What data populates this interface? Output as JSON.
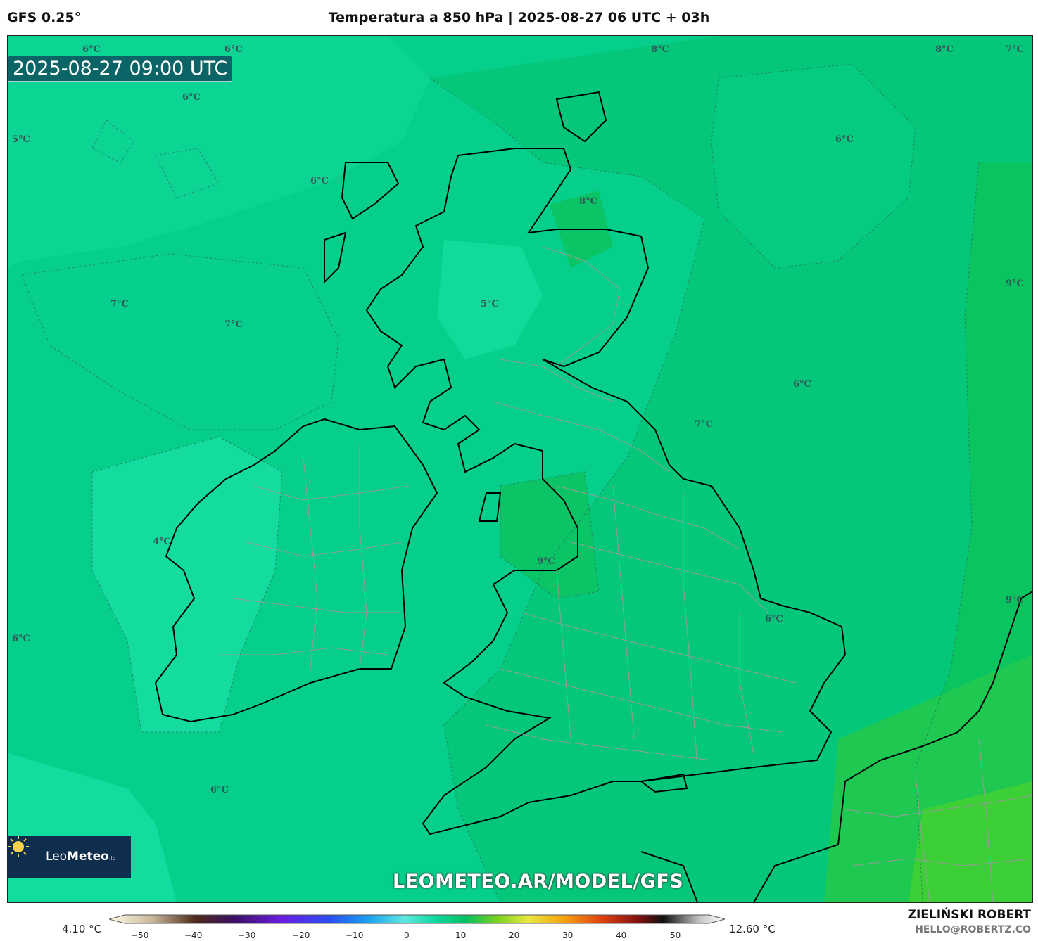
{
  "header": {
    "model": "GFS 0.25°",
    "title": "Temperatura a 850 hPa | 2025-08-27 06 UTC + 03h"
  },
  "valid_time": "2025-08-27 09:00 UTC",
  "map": {
    "region": "British Isles",
    "labels": [
      "6°C",
      "6°C",
      "8°C",
      "8°C",
      "7°C",
      "5°C",
      "6°C",
      "6°C",
      "6°C",
      "8°C",
      "7°C",
      "7°C",
      "9°C",
      "5°C",
      "6°C",
      "7°C",
      "4°C",
      "9°C",
      "9°C",
      "6°C",
      "6°C",
      "6°C"
    ]
  },
  "watermark": "LEOMETEO.AR/MODEL/GFS",
  "logo": {
    "text_regular": "Leo",
    "text_bold": "Meteo",
    "suffix": ".io"
  },
  "colorbar": {
    "min_label": "4.10 °C",
    "max_label": "12.60 °C",
    "ticks": [
      "−50",
      "−40",
      "−30",
      "−20",
      "−10",
      "0",
      "10",
      "20",
      "30",
      "40",
      "50"
    ]
  },
  "credits": {
    "author": "ZIELIŃSKI ROBERT",
    "email": "HELLO@ROBERTZ.CO"
  },
  "colors": {
    "base_field": "#05cf8a",
    "cool_field": "#12dc9c",
    "warm_field": "#06c86a",
    "warmest_field": "#2fd03a",
    "coast": "#000000",
    "borders": "#9a9a9a"
  }
}
